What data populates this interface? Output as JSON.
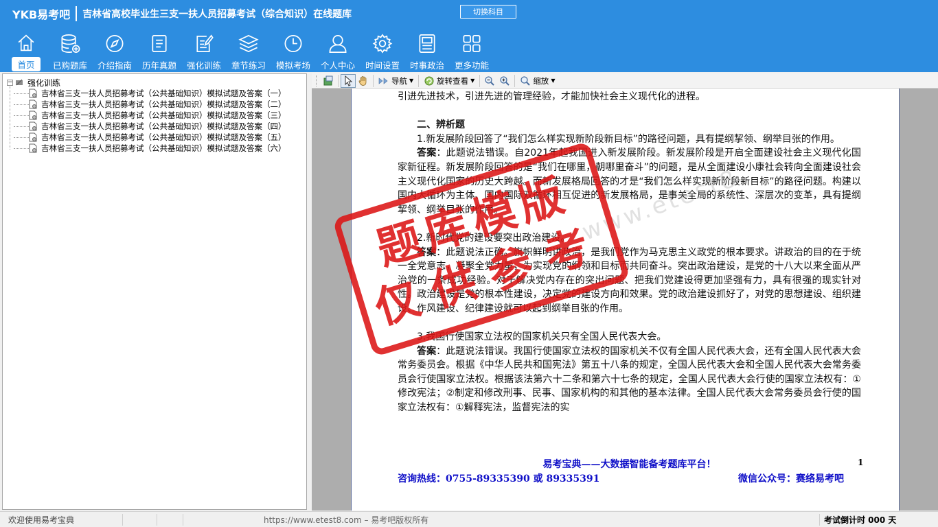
{
  "app": {
    "logo": "YKB易考吧",
    "title": "吉林省高校毕业生三支一扶人员招募考试（综合知识）在线题库",
    "switch_label": "切换科目"
  },
  "nav": {
    "items": [
      {
        "label": "首页",
        "icon": "home-icon",
        "active": true
      },
      {
        "label": "已购题库",
        "icon": "database-icon"
      },
      {
        "label": "介绍指南",
        "icon": "compass-icon"
      },
      {
        "label": "历年真题",
        "icon": "list-doc-icon"
      },
      {
        "label": "强化训练",
        "icon": "edit-doc-icon"
      },
      {
        "label": "章节练习",
        "icon": "layers-icon"
      },
      {
        "label": "模拟考场",
        "icon": "clock-icon"
      },
      {
        "label": "个人中心",
        "icon": "user-icon"
      },
      {
        "label": "时间设置",
        "icon": "gear-icon"
      },
      {
        "label": "时事政治",
        "icon": "news-icon"
      },
      {
        "label": "更多功能",
        "icon": "grid-icon"
      }
    ]
  },
  "tree": {
    "root_toggle": "−",
    "root": "强化训练",
    "items": [
      "吉林省三支一扶人员招募考试（公共基础知识）模拟试题及答案（一）",
      "吉林省三支一扶人员招募考试（公共基础知识）模拟试题及答案（二）",
      "吉林省三支一扶人员招募考试（公共基础知识）模拟试题及答案（三）",
      "吉林省三支一扶人员招募考试（公共基础知识）模拟试题及答案（四）",
      "吉林省三支一扶人员招募考试（公共基础知识）模拟试题及答案（五）",
      "吉林省三支一扶人员招募考试（公共基础知识）模拟试题及答案（六）"
    ]
  },
  "viewer_toolbar": {
    "nav_label": "导航",
    "rotate_label": "旋转查看",
    "zoom_label": "缩放"
  },
  "document": {
    "line0": "引进先进技术，引进先进的管理经验，才能加快社会主义现代化的进程。",
    "section": "二、辨析题",
    "q1": "1.新发展阶段回答了“我们怎么样实现新阶段新目标”的路径问题，具有提纲挈领、纲举目张的作用。",
    "answer_label": "答案",
    "a1": "：此题说法错误。自2021年起我国进入新发展阶段。新发展阶段是开启全面建设社会主义现代化国家新征程。新发展阶段回答的是“我们在哪里，朝哪里奋斗”的问题，是从全面建设小康社会转向全面建设社会主义现代化国家的历史大跨越。而新发展格局回答的才是“我们怎么样实现新阶段新目标”的路径问题。构建以国内大循环为主体、国内国际双循环相互促进的新发展格局，是事关全局的系统性、深层次的变革，具有提纲挈领、纲举目张的作用。",
    "q2": "2.新时代党的建设要突出政治建设。",
    "a2": "：此题说法正确。旗帜鲜明讲政治，是我们党作为马克思主义政党的根本要求。讲政治的目的在于统一全党意志，凝聚全党力量，为实现党的纲领和目标而共同奋斗。突出政治建设，是党的十八大以来全面从严治党的一条成功经验。对于解决党内存在的突出问题、把我们党建设得更加坚强有力，具有很强的现实针对性。政治建设是党的根本性建设，决定党的建设方向和效果。党的政治建设抓好了，对党的思想建设、组织建设、作风建设、纪律建设就可以起到纲举目张的作用。",
    "q3": "3.我国行使国家立法权的国家机关只有全国人民代表大会。",
    "a3": "：此题说法错误。我国行使国家立法权的国家机关不仅有全国人民代表大会，还有全国人民代表大会常务委员会。根据《中华人民共和国宪法》第五十八条的规定，全国人民代表大会和全国人民代表大会常务委员会行使国家立法权。根据该法第六十二条和第六十七条的规定，全国人民代表大会行使的国家立法权有：①修改宪法；②制定和修改刑事、民事、国家机构的和其他的基本法律。全国人民代表大会常务委员会行使的国家立法权有：①解释宪法，监督宪法的实",
    "footer_slogan": "易考宝典——大数据智能备考题库平台！",
    "page_number": "1",
    "hotline": "咨询热线：0755-89335390 或 89335391",
    "wechat": "微信公众号：赛络易考吧",
    "watermark_url": "www.etest8",
    "stamp_line1": "题库模版",
    "stamp_line2": "仅供参考"
  },
  "status": {
    "welcome": "欢迎使用易考宝典",
    "site": "https://www.etest8.com – 易考吧版权所有",
    "countdown": "考试倒计时 000 天"
  },
  "colors": {
    "header_blue": "#2d8de0",
    "footer_blue": "#1010c8",
    "stamp_red": "#dc1414"
  }
}
